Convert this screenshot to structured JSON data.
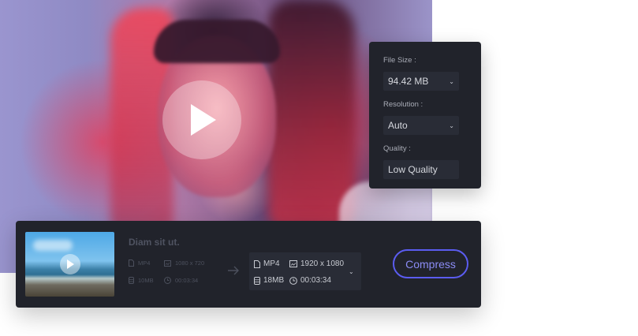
{
  "settings": {
    "file_size_label": "File Size :",
    "file_size_value": "94.42 MB",
    "resolution_label": "Resolution :",
    "resolution_value": "Auto",
    "quality_label": "Quality :",
    "quality_value": "Low Quality"
  },
  "file": {
    "title": "Diam sit ut.",
    "source": {
      "format": "MP4",
      "resolution": "1080 x 720",
      "size": "10MB",
      "duration": "00:03:34"
    },
    "output": {
      "format": "MP4",
      "resolution": "1920 x 1080",
      "size": "18MB",
      "duration": "00:03:34"
    }
  },
  "actions": {
    "compress_label": "Compress"
  },
  "colors": {
    "panel_bg": "#21232b",
    "field_bg": "#292c36",
    "accent": "#5b5cf0"
  },
  "icons": [
    "play-icon",
    "chevron-down-icon",
    "file-icon",
    "resolution-icon",
    "database-icon",
    "clock-icon",
    "arrow-right-icon"
  ]
}
